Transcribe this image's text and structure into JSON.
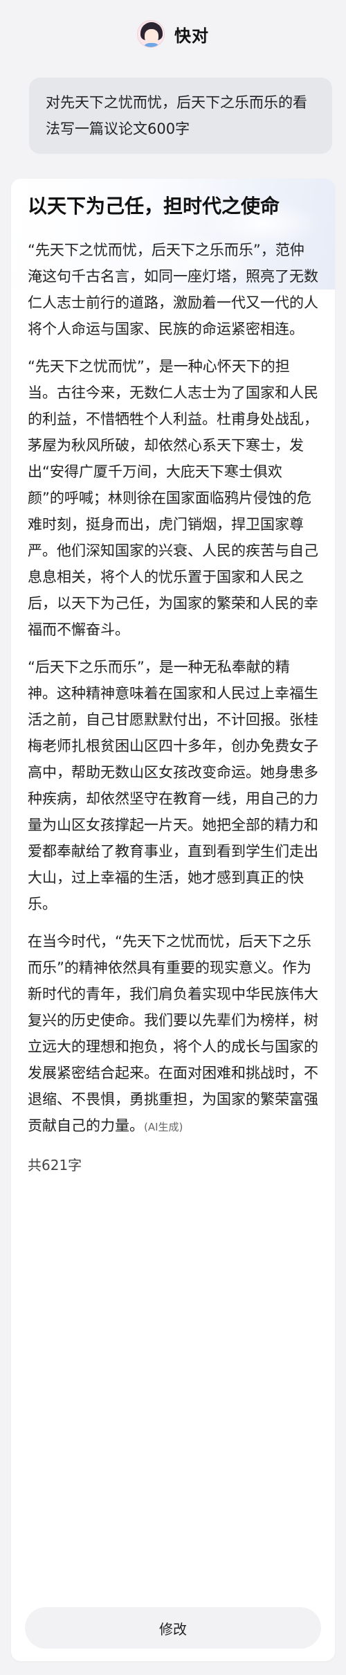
{
  "header": {
    "title": "快对"
  },
  "prompt": {
    "text": "对先天下之忧而忧，后天下之乐而乐的看法写一篇议论文600字"
  },
  "answer": {
    "title": "以天下为己任，担时代之使命",
    "paragraphs": [
      "“先天下之忧而忧，后天下之乐而乐”，范仲淹这句千古名言，如同一座灯塔，照亮了无数仁人志士前行的道路，激励着一代又一代的人将个人命运与国家、民族的命运紧密相连。",
      "“先天下之忧而忧”，是一种心怀天下的担当。古往今来，无数仁人志士为了国家和人民的利益，不惜牺牲个人利益。杜甫身处战乱，茅屋为秋风所破，却依然心系天下寒士，发出“安得广厦千万间，大庇天下寒士俱欢颜”的呼喊；林则徐在国家面临鸦片侵蚀的危难时刻，挺身而出，虎门销烟，捍卫国家尊严。他们深知国家的兴衰、人民的疾苦与自己息息相关，将个人的忧乐置于国家和人民之后，以天下为己任，为国家的繁荣和人民的幸福而不懈奋斗。",
      "“后天下之乐而乐”，是一种无私奉献的精神。这种精神意味着在国家和人民过上幸福生活之前，自己甘愿默默付出，不计回报。张桂梅老师扎根贫困山区四十多年，创办免费女子高中，帮助无数山区女孩改变命运。她身患多种疾病，却依然坚守在教育一线，用自己的力量为山区女孩撑起一片天。她把全部的精力和爱都奉献给了教育事业，直到看到学生们走出大山，过上幸福的生活，她才感到真正的快乐。",
      "在当今时代，“先天下之忧而忧，后天下之乐而乐”的精神依然具有重要的现实意义。作为新时代的青年，我们肩负着实现中华民族伟大复兴的历史使命。我们要以先辈们为榜样，树立远大的理想和抱负，将个人的成长与国家的发展紧密结合起来。在面对困难和挑战时，不退缩、不畏惧，勇挑重担，为国家的繁荣富强贡献自己的力量。"
    ],
    "ai_tag": "(AI生成)",
    "word_count": "共621字"
  },
  "actions": {
    "edit_label": "修改"
  }
}
